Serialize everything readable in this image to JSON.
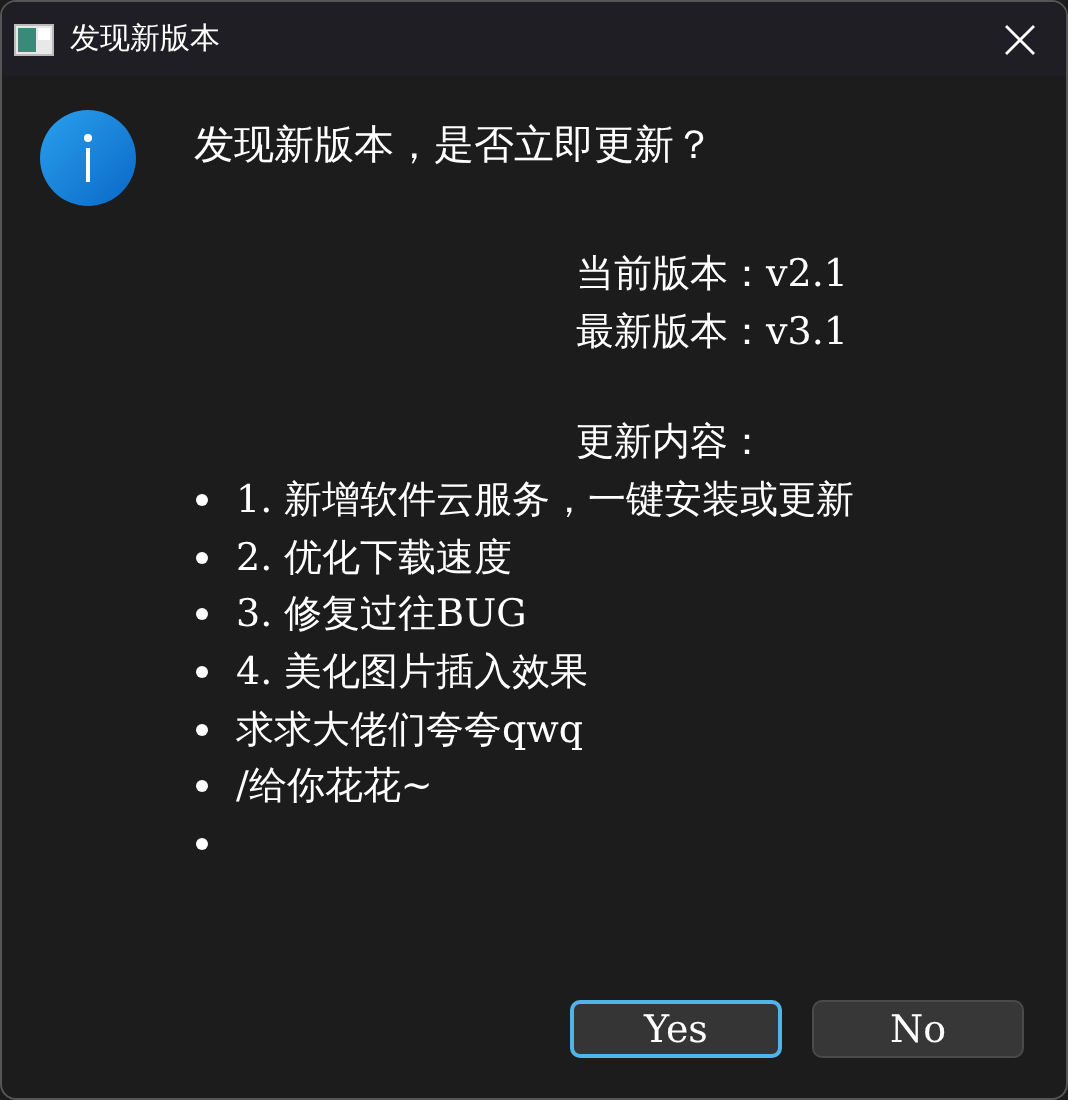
{
  "window": {
    "title": "发现新版本"
  },
  "message": {
    "headline": "发现新版本，是否立即更新？",
    "info_lines": [
      "当前版本：v2.1",
      "最新版本：v3.1"
    ],
    "changes_heading": "更新内容：",
    "changes": [
      {
        "kind": "text",
        "text": "1. 新增软件云服务，一键安装或更新"
      },
      {
        "kind": "text",
        "text": "2. 优化下载速度"
      },
      {
        "kind": "text",
        "text": "3. 修复过往BUG"
      },
      {
        "kind": "text",
        "text": "4. 美化图片插入效果"
      },
      {
        "kind": "text",
        "text": "求求大佬们夸夸qwq"
      },
      {
        "kind": "text",
        "text": "/给你花花~"
      },
      {
        "kind": "blank"
      }
    ]
  },
  "buttons": [
    {
      "label": "Yes",
      "focused": true
    },
    {
      "label": "No",
      "focused": false
    }
  ]
}
